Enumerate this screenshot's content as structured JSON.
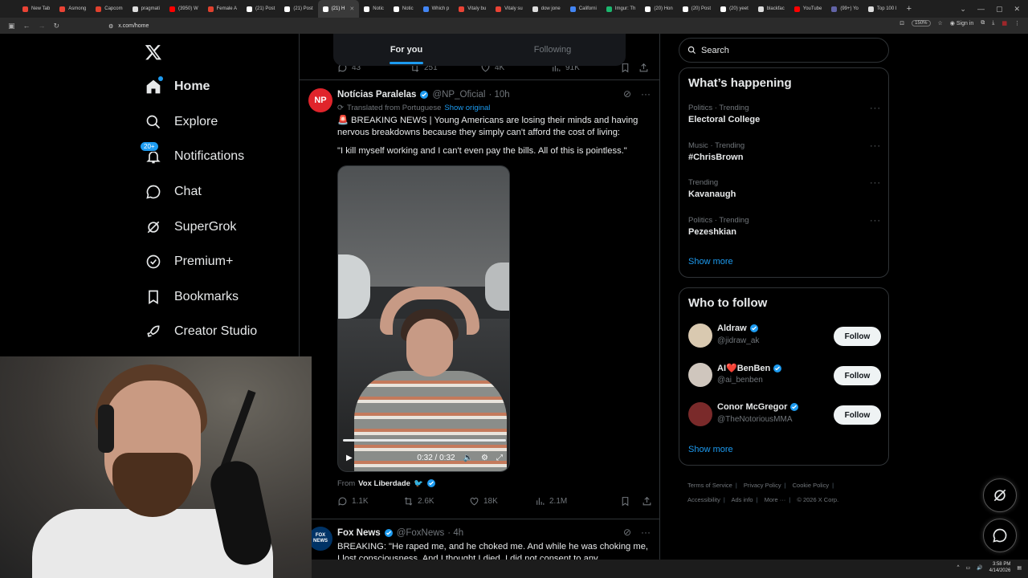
{
  "browser": {
    "tabs": [
      {
        "label": "New Tab",
        "color": "#ea4335"
      },
      {
        "label": "Asmong",
        "color": "#ea4335"
      },
      {
        "label": "Capcom",
        "color": "#e0412e"
      },
      {
        "label": "pragmati",
        "color": "#dddddd"
      },
      {
        "label": "(3950) W",
        "color": "#ff0000"
      },
      {
        "label": "Female A",
        "color": "#e0412e"
      },
      {
        "label": "(21) Post",
        "color": "#ffffff"
      },
      {
        "label": "(21) Post",
        "color": "#ffffff"
      },
      {
        "label": "(21) H",
        "color": "#ffffff"
      },
      {
        "label": "Notic",
        "color": "#ffffff"
      },
      {
        "label": "Notic",
        "color": "#ffffff"
      },
      {
        "label": "Which p",
        "color": "#4285f4"
      },
      {
        "label": "Vitaly bu",
        "color": "#ea4335"
      },
      {
        "label": "Vitaly su",
        "color": "#ea4335"
      },
      {
        "label": "dow jone",
        "color": "#dddddd"
      },
      {
        "label": "Californi",
        "color": "#4285f4"
      },
      {
        "label": "Imgur: Th",
        "color": "#1bb76e"
      },
      {
        "label": "(20) Hon",
        "color": "#ffffff"
      },
      {
        "label": "(20) Post",
        "color": "#ffffff"
      },
      {
        "label": "(20) yeet",
        "color": "#ffffff"
      },
      {
        "label": "blackfac",
        "color": "#dddddd"
      },
      {
        "label": "YouTube",
        "color": "#ff0000"
      },
      {
        "label": "(99+) Yo",
        "color": "#6264a7"
      },
      {
        "label": "Top 100 I",
        "color": "#dddddd"
      }
    ],
    "active_tab_index": 8,
    "url": "x.com/home",
    "zoom": "150%",
    "sign_in": "Sign in"
  },
  "sidebar": {
    "items": [
      {
        "label": "Home",
        "icon": "home-icon"
      },
      {
        "label": "Explore",
        "icon": "search-icon"
      },
      {
        "label": "Notifications",
        "icon": "bell-icon",
        "badge": "20+"
      },
      {
        "label": "Chat",
        "icon": "chat-icon"
      },
      {
        "label": "SuperGrok",
        "icon": "grok-icon"
      },
      {
        "label": "Premium+",
        "icon": "verified-icon"
      },
      {
        "label": "Bookmarks",
        "icon": "bookmark-icon"
      },
      {
        "label": "Creator Studio",
        "icon": "rocket-icon"
      }
    ]
  },
  "timeline": {
    "tabs": [
      "For you",
      "Following"
    ],
    "prev_post_stats": {
      "replies": "43",
      "reposts": "251",
      "likes": "4K",
      "views": "91K"
    },
    "post1": {
      "avatar_text": "NP",
      "avatar_color": "#e0242b",
      "name": "Notícias Paralelas",
      "handle": "@NP_Oficial",
      "time": "· 10h",
      "translated": "Translated from Portuguese",
      "show_original": "Show original",
      "text1": "🚨 BREAKING NEWS | Young Americans are losing their minds and having nervous breakdowns because they simply can't afford the cost of living:",
      "text2": "\"I kill myself working and I can't even pay the bills. All of this is pointless.\"",
      "video_time": "0:32 / 0:32",
      "from_label": "From",
      "from_source": "Vox Liberdade",
      "stats": {
        "replies": "1.1K",
        "reposts": "2.6K",
        "likes": "18K",
        "views": "2.1M"
      }
    },
    "post2": {
      "avatar_text": "FOX NEWS",
      "avatar_color": "#003366",
      "name": "Fox News",
      "handle": "@FoxNews",
      "time": "· 4h",
      "text": "BREAKING: \"He raped me, and he choked me. And while he was choking me, I lost consciousness. And I thought I died. I did not consent to any"
    }
  },
  "right": {
    "search_placeholder": "Search",
    "whats_happening": "What’s happening",
    "trends": [
      {
        "meta": "Politics · Trending",
        "name": "Electoral College"
      },
      {
        "meta": "Music · Trending",
        "name": "#ChrisBrown"
      },
      {
        "meta": "Trending",
        "name": "Kavanaugh"
      },
      {
        "meta": "Politics · Trending",
        "name": "Pezeshkian"
      }
    ],
    "show_more": "Show more",
    "who_to_follow": "Who to follow",
    "follow_suggestions": [
      {
        "name": "Aldraw",
        "handle": "@jidraw_ak",
        "avatar_color": "#d9c9b0"
      },
      {
        "name": "AI❤️BenBen",
        "handle": "@ai_benben",
        "avatar_color": "#cfc6bd"
      },
      {
        "name": "Conor McGregor",
        "handle": "@TheNotoriousMMA",
        "avatar_color": "#7a2a2a"
      }
    ],
    "follow_label": "Follow",
    "footer": [
      "Terms of Service",
      "Privacy Policy",
      "Cookie Policy",
      "Accessibility",
      "Ads info",
      "More ···",
      "© 2026 X Corp."
    ]
  },
  "taskbar": {
    "time": "3:58 PM",
    "date": "4/14/2026"
  }
}
